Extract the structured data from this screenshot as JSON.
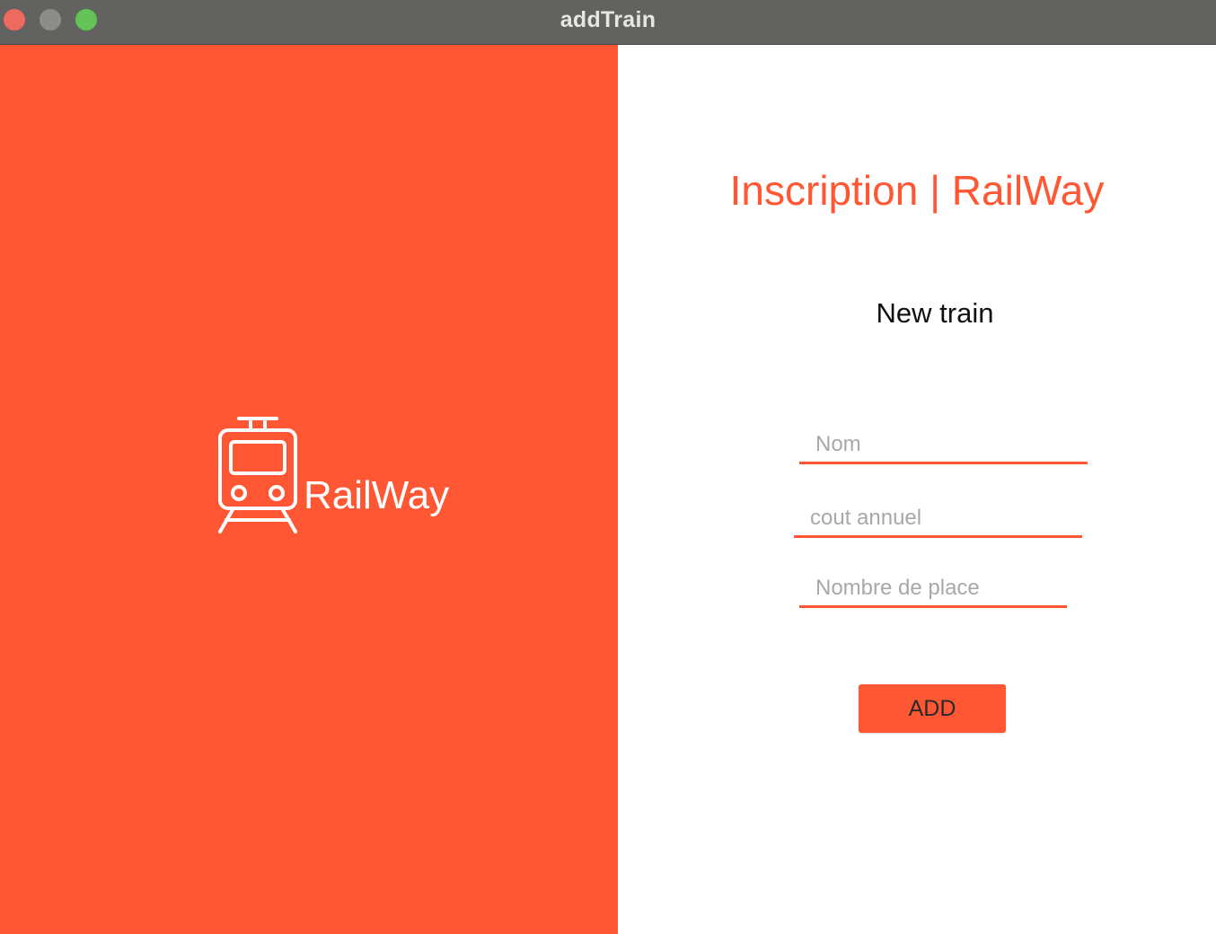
{
  "window": {
    "title": "addTrain"
  },
  "colors": {
    "brand": "#ff5733",
    "white": "#ffffff"
  },
  "brand_panel": {
    "logo_text": "RailWay",
    "icon": "train-icon"
  },
  "form": {
    "heading": "Inscription | RailWay",
    "title": "New train",
    "fields": {
      "nom": {
        "placeholder": "Nom",
        "value": ""
      },
      "cout_annuel": {
        "placeholder": "cout annuel",
        "value": ""
      },
      "nombre_de_place": {
        "placeholder": "Nombre de place",
        "value": ""
      }
    },
    "submit_label": "ADD"
  }
}
